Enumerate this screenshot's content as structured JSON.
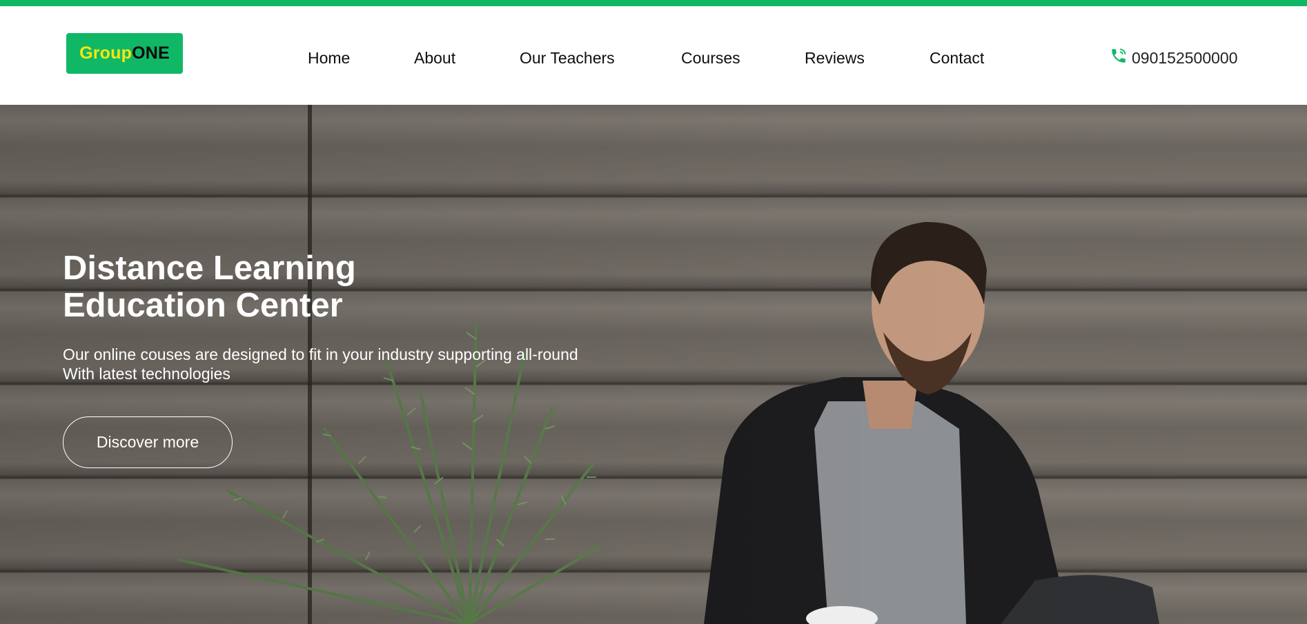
{
  "brand": {
    "logo_part_a": "Group",
    "logo_part_b": "ONE",
    "colors": {
      "accent": "#10b866",
      "logo_highlight": "#f5e70f",
      "top_stripe": "#0fb862"
    }
  },
  "nav": {
    "items": [
      {
        "label": "Home"
      },
      {
        "label": "About"
      },
      {
        "label": "Our Teachers"
      },
      {
        "label": "Courses"
      },
      {
        "label": "Reviews"
      },
      {
        "label": "Contact"
      }
    ]
  },
  "contact": {
    "phone_icon": "phone-icon",
    "phone_number": "090152500000"
  },
  "hero": {
    "title_line1": "Distance Learning",
    "title_line2": "Education Center",
    "subtitle_line1": "Our online couses are designed to fit in your industry supporting all-round",
    "subtitle_line2": "With latest technologies",
    "button_label": "Discover more"
  }
}
